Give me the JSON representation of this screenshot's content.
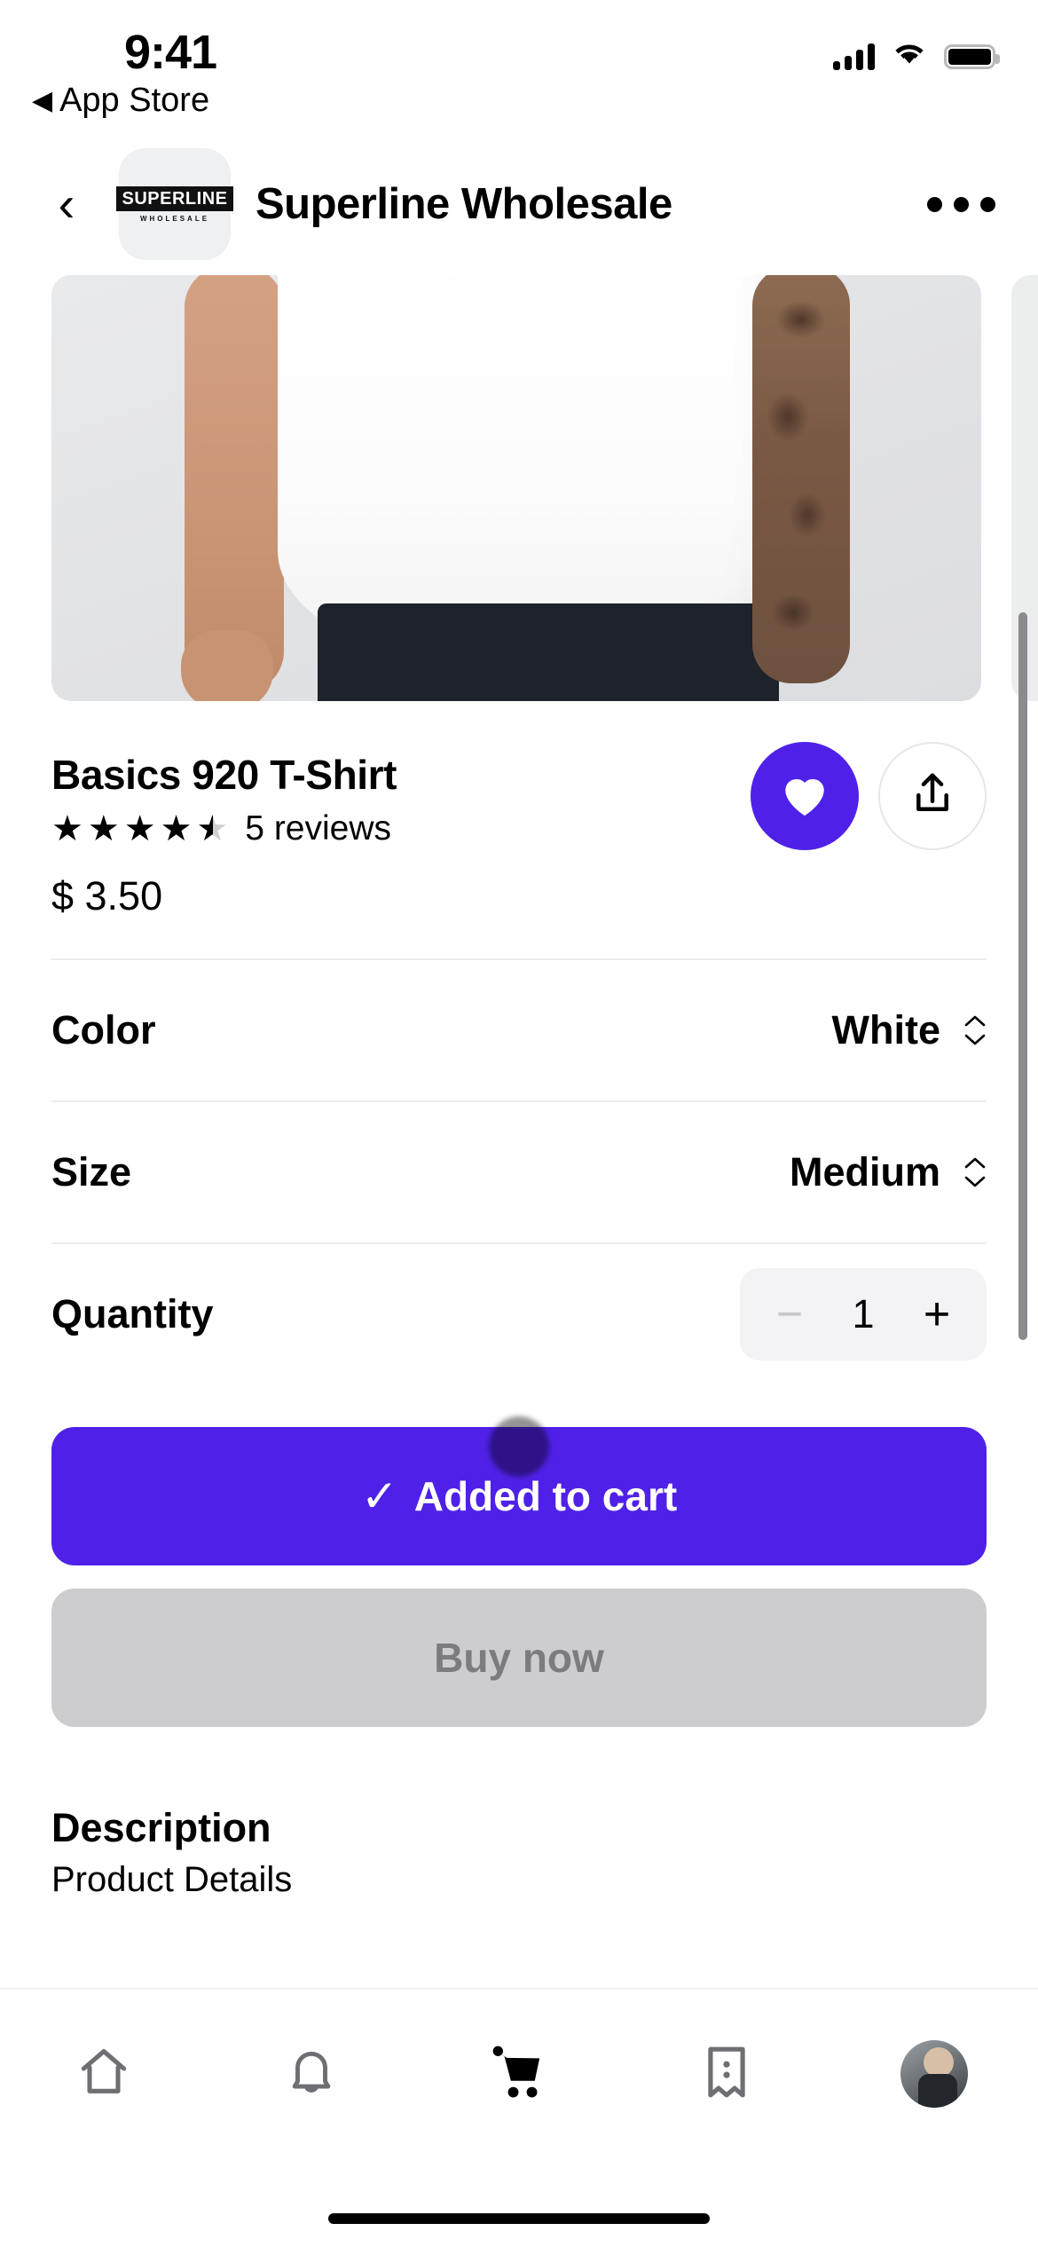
{
  "status_bar": {
    "time": "9:41",
    "back_app_label": "App Store",
    "back_triangle": "◀",
    "cellular_icon": "cellular-signal-icon",
    "wifi_icon": "wifi-icon",
    "battery_icon": "battery-full-icon"
  },
  "nav": {
    "back_glyph": "‹",
    "store_logo_main": "SUPERLINE",
    "store_logo_sub": "WHOLESALE",
    "store_name": "Superline Wholesale",
    "more_icon": "more-horizontal-icon"
  },
  "gallery": {
    "image_alt": "Model wearing white t-shirt with tattooed arm",
    "next_image_alt": "Next product photo"
  },
  "product": {
    "title": "Basics 920 T-Shirt",
    "rating_value": 4.5,
    "rating_max": 5,
    "reviews_label": "5 reviews",
    "price": "$ 3.50",
    "favorite_icon": "heart-filled-icon",
    "favorite_active": true,
    "share_icon": "share-upload-icon"
  },
  "options": [
    {
      "label": "Color",
      "value": "White",
      "selector_icon": "chevron-up-down-icon"
    },
    {
      "label": "Size",
      "value": "Medium",
      "selector_icon": "chevron-up-down-icon"
    }
  ],
  "quantity": {
    "label": "Quantity",
    "value": "1",
    "minus_label": "−",
    "plus_label": "+",
    "minus_disabled": true
  },
  "actions": {
    "add_to_cart_label": "Added to cart",
    "add_to_cart_tick": "✓",
    "buy_now_label": "Buy now",
    "buy_now_disabled": true
  },
  "description": {
    "heading": "Description",
    "subheading": "Product Details"
  },
  "tabbar": {
    "items": [
      {
        "name": "home-icon",
        "active": false
      },
      {
        "name": "bell-icon",
        "active": false
      },
      {
        "name": "cart-icon",
        "active": true
      },
      {
        "name": "receipt-icon",
        "active": false
      },
      {
        "name": "avatar",
        "active": false
      }
    ]
  },
  "colors": {
    "accent_purple": "#4f21e8",
    "disabled_gray": "#cdcdcf",
    "disabled_text": "#7c7c80",
    "divider": "#ececee",
    "chip_bg": "#f3f3f5",
    "scrollbar": "#8a8a8f"
  }
}
